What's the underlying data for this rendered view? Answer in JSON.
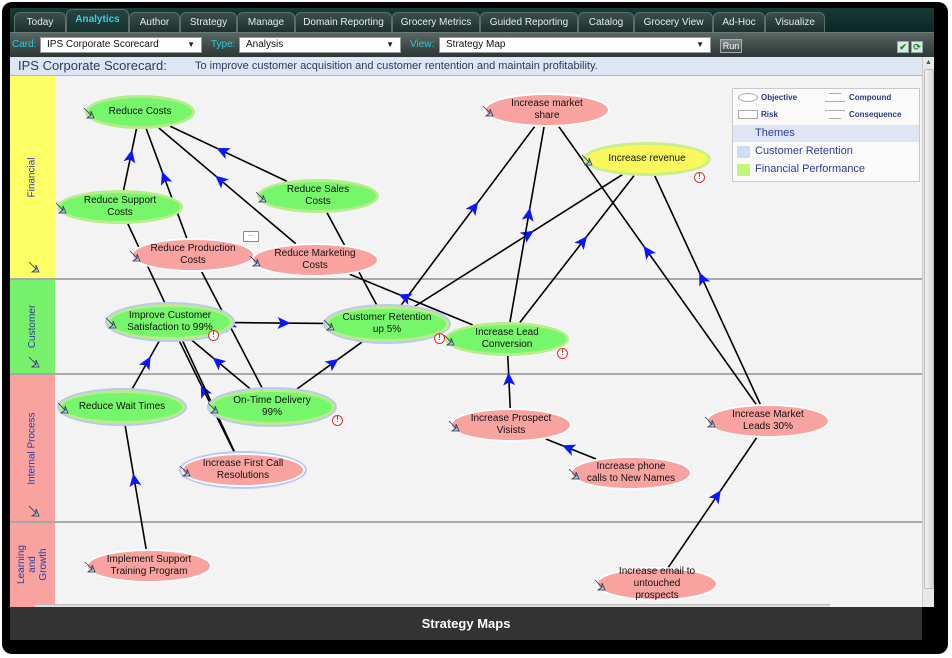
{
  "tabs": [
    {
      "label": "Today",
      "active": false
    },
    {
      "label": "Analytics",
      "active": true
    },
    {
      "label": "Author",
      "active": false
    },
    {
      "label": "Strategy",
      "active": false
    },
    {
      "label": "Manage",
      "active": false
    },
    {
      "label": "Domain Reporting",
      "active": false
    },
    {
      "label": "Grocery Metrics",
      "active": false
    },
    {
      "label": "Guided Reporting",
      "active": false
    },
    {
      "label": "Catalog",
      "active": false
    },
    {
      "label": "Grocery View",
      "active": false
    },
    {
      "label": "Ad-Hoc",
      "active": false
    },
    {
      "label": "Visualize",
      "active": false
    }
  ],
  "toolbar": {
    "card_label": "Card:",
    "card_value": "IPS Corporate Scorecard",
    "type_label": "Type:",
    "type_value": "Analysis",
    "view_label": "View:",
    "view_value": "Strategy Map",
    "run_label": "Run",
    "save_icon": "check-icon",
    "refresh_icon": "refresh-icon"
  },
  "description": {
    "title": "IPS Corporate Scorecard:",
    "text": "To improve customer acquisition and customer rentention and maintain profitability."
  },
  "perspectives": [
    {
      "label": "Financial",
      "color": "#ffff66"
    },
    {
      "label": "Customer",
      "color": "#77f06b"
    },
    {
      "label": "Internal Process",
      "color": "#f9a3a1"
    },
    {
      "label": "Learning and Growth",
      "color": "#f9a3a1"
    }
  ],
  "legend": {
    "shapes": [
      {
        "label": "Objective"
      },
      {
        "label": "Compound"
      },
      {
        "label": "Risk"
      },
      {
        "label": "Consequence"
      }
    ],
    "themes_header": "Themes",
    "themes": [
      {
        "label": "Customer Retention",
        "color": "#cfdcf6"
      },
      {
        "label": "Financial Performance",
        "color": "#c2f57a"
      }
    ]
  },
  "objectives": [
    {
      "id": "reduce-costs",
      "label": "Reduce Costs",
      "status": "green",
      "theme": "financial",
      "alert": false
    },
    {
      "id": "reduce-support-costs",
      "label": "Reduce Support Costs",
      "status": "green",
      "theme": "financial",
      "alert": false
    },
    {
      "id": "reduce-sales-costs",
      "label": "Reduce Sales Costs",
      "status": "green",
      "theme": "financial",
      "alert": false
    },
    {
      "id": "reduce-production-costs",
      "label": "Reduce Production Costs",
      "status": "pink",
      "theme": "financial",
      "alert": false,
      "comment": true
    },
    {
      "id": "reduce-marketing-costs",
      "label": "Reduce Marketing Costs",
      "status": "pink",
      "theme": "financial",
      "alert": false
    },
    {
      "id": "increase-market-share",
      "label": "Increase market share",
      "status": "pink",
      "theme": "none",
      "alert": false
    },
    {
      "id": "increase-revenue",
      "label": "Increase revenue",
      "status": "yellow",
      "theme": "financial",
      "alert": true
    },
    {
      "id": "improve-customer-satisfaction",
      "label": "Improve Customer Satisfaction to 99%",
      "status": "green",
      "theme": "customer",
      "alert": true
    },
    {
      "id": "customer-retention",
      "label": "Customer Retention up 5%",
      "status": "green",
      "theme": "customer",
      "alert": true
    },
    {
      "id": "increase-lead-conversion",
      "label": "Increase Lead Conversion",
      "status": "green",
      "theme": "none",
      "alert": true
    },
    {
      "id": "reduce-wait-times",
      "label": "Reduce Wait Times",
      "status": "green",
      "theme": "customer",
      "alert": false
    },
    {
      "id": "on-time-delivery",
      "label": "On-Time Delivery 99%",
      "status": "green",
      "theme": "customer",
      "alert": true
    },
    {
      "id": "increase-first-call-resolutions",
      "label": "Increase First Call Resolutions",
      "status": "pink",
      "theme": "customer",
      "alert": false
    },
    {
      "id": "increase-prospect-visits",
      "label": "Increase Prospect Visists",
      "status": "pink",
      "theme": "none",
      "alert": false
    },
    {
      "id": "increase-phone-calls",
      "label": "Increase phone calls to New Names",
      "status": "pink",
      "theme": "none",
      "alert": false
    },
    {
      "id": "increase-market-leads",
      "label": "Increase Market Leads 30%",
      "status": "pink",
      "theme": "none",
      "alert": false
    },
    {
      "id": "implement-support-training",
      "label": "Implement Support Training Program",
      "status": "pink",
      "theme": "none",
      "alert": false
    },
    {
      "id": "increase-email",
      "label": "Increase email to untouched prospects",
      "status": "pink",
      "theme": "none",
      "alert": false
    }
  ],
  "links": [
    [
      "reduce-support-costs",
      "reduce-costs"
    ],
    [
      "reduce-production-costs",
      "reduce-costs"
    ],
    [
      "reduce-marketing-costs",
      "reduce-costs"
    ],
    [
      "reduce-sales-costs",
      "reduce-costs"
    ],
    [
      "reduce-wait-times",
      "improve-customer-satisfaction"
    ],
    [
      "on-time-delivery",
      "improve-customer-satisfaction"
    ],
    [
      "increase-first-call-resolutions",
      "improve-customer-satisfaction"
    ],
    [
      "implement-support-training",
      "reduce-wait-times"
    ],
    [
      "improve-customer-satisfaction",
      "customer-retention"
    ],
    [
      "on-time-delivery",
      "customer-retention"
    ],
    [
      "on-time-delivery",
      "reduce-production-costs"
    ],
    [
      "increase-first-call-resolutions",
      "reduce-support-costs"
    ],
    [
      "customer-retention",
      "reduce-sales-costs"
    ],
    [
      "customer-retention",
      "increase-market-share"
    ],
    [
      "customer-retention",
      "increase-revenue"
    ],
    [
      "increase-lead-conversion",
      "reduce-marketing-costs"
    ],
    [
      "increase-lead-conversion",
      "increase-market-share"
    ],
    [
      "increase-lead-conversion",
      "increase-revenue"
    ],
    [
      "increase-prospect-visits",
      "increase-lead-conversion"
    ],
    [
      "increase-phone-calls",
      "increase-prospect-visits"
    ],
    [
      "increase-market-leads",
      "increase-market-share"
    ],
    [
      "increase-market-leads",
      "increase-revenue"
    ],
    [
      "increase-email",
      "increase-market-leads"
    ]
  ],
  "footer": {
    "title": "Strategy Maps"
  }
}
